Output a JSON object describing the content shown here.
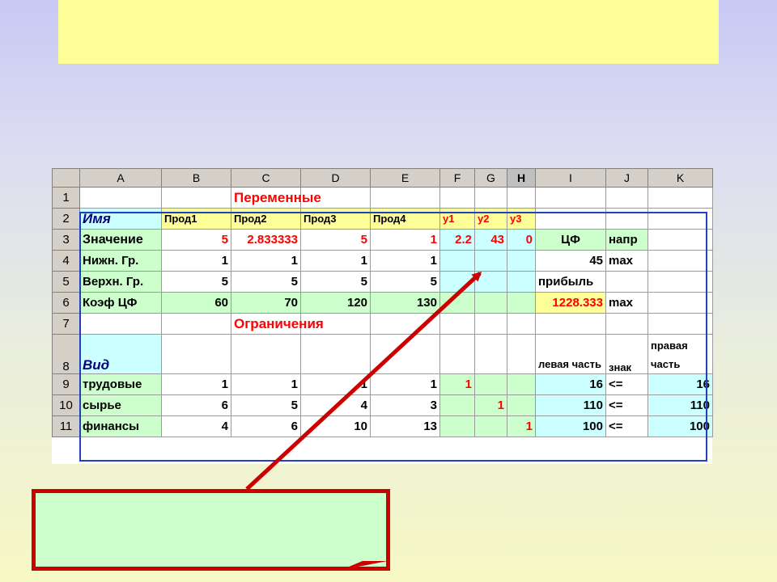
{
  "sheet": {
    "columns": [
      "",
      "A",
      "B",
      "C",
      "D",
      "E",
      "F",
      "G",
      "H",
      "I",
      "J",
      "K"
    ],
    "active_column": "H",
    "rows": [
      {
        "n": "1",
        "cells": [
          "",
          "",
          "Переменные",
          "",
          "",
          "",
          "",
          "",
          "",
          "",
          ""
        ]
      },
      {
        "n": "2",
        "cells": [
          "Имя",
          "Прод1",
          "Прод2",
          "Прод3",
          "Прод4",
          "y1",
          "y2",
          "y3",
          "",
          "",
          ""
        ]
      },
      {
        "n": "3",
        "cells": [
          "Значение",
          "5",
          "2.833333",
          "5",
          "1",
          "2.2",
          "43",
          "0",
          "ЦФ",
          "напр",
          ""
        ]
      },
      {
        "n": "4",
        "cells": [
          "Нижн. Гр.",
          "1",
          "1",
          "1",
          "1",
          "",
          "",
          "",
          "45",
          "max",
          ""
        ]
      },
      {
        "n": "5",
        "cells": [
          "Верхн. Гр.",
          "5",
          "5",
          "5",
          "5",
          "",
          "",
          "",
          "прибыль",
          "",
          ""
        ]
      },
      {
        "n": "6",
        "cells": [
          "Коэф ЦФ",
          "60",
          "70",
          "120",
          "130",
          "",
          "",
          "",
          "1228.333",
          "max",
          ""
        ]
      },
      {
        "n": "7",
        "cells": [
          "",
          "",
          "Ограничения",
          "",
          "",
          "",
          "",
          "",
          "",
          "",
          ""
        ]
      },
      {
        "n": "8",
        "cells": [
          "Вид",
          "",
          "",
          "",
          "",
          "",
          "",
          "",
          "левая часть",
          "знак",
          "правая часть"
        ]
      },
      {
        "n": "9",
        "cells": [
          "трудовые",
          "1",
          "1",
          "1",
          "1",
          "1",
          "",
          "",
          "16",
          "<=",
          "16"
        ]
      },
      {
        "n": "10",
        "cells": [
          "сырье",
          "6",
          "5",
          "4",
          "3",
          "",
          "1",
          "",
          "110",
          "<=",
          "110"
        ]
      },
      {
        "n": "11",
        "cells": [
          "финансы",
          "4",
          "6",
          "10",
          "13",
          "",
          "",
          "1",
          "100",
          "<=",
          "100"
        ]
      }
    ]
  },
  "colors": {
    "title_box": "#ffff99",
    "callout_fill": "#ccffcc",
    "callout_border": "#cc0000",
    "arrow": "#cc0000",
    "frame": "#2040c0"
  }
}
